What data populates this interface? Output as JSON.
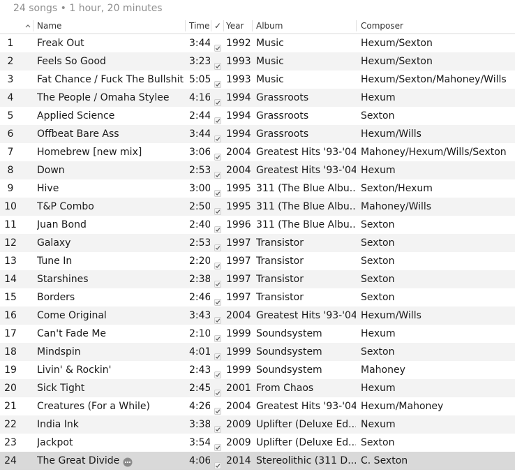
{
  "summary": {
    "text": "24 songs • 1 hour, 20 minutes"
  },
  "columns": {
    "name": "Name",
    "time": "Time",
    "check": "✓",
    "year": "Year",
    "album": "Album",
    "composer": "Composer"
  },
  "icons": {
    "sort": "chevron-up-icon",
    "check": "checkmark-icon",
    "more": "more-options-icon"
  },
  "colors": {
    "row_stripe": "#f3f3f3",
    "row_selected": "#d9d9d9",
    "summary_text": "#8f8f8f"
  },
  "tracks": [
    {
      "num": "1",
      "name": "Freak Out",
      "time": "3:44",
      "year": "1992",
      "album": "Music",
      "composer": "Hexum/Sexton"
    },
    {
      "num": "2",
      "name": "Feels So Good",
      "time": "3:23",
      "year": "1993",
      "album": "Music",
      "composer": "Hexum/Sexton"
    },
    {
      "num": "3",
      "name": "Fat Chance / Fuck The Bullshit",
      "time": "5:05",
      "year": "1993",
      "album": "Music",
      "composer": "Hexum/Sexton/Mahoney/Wills"
    },
    {
      "num": "4",
      "name": "The People / Omaha Stylee",
      "time": "4:16",
      "year": "1994",
      "album": "Grassroots",
      "composer": "Hexum"
    },
    {
      "num": "5",
      "name": "Applied Science",
      "time": "2:44",
      "year": "1994",
      "album": "Grassroots",
      "composer": "Sexton"
    },
    {
      "num": "6",
      "name": "Offbeat Bare Ass",
      "time": "3:44",
      "year": "1994",
      "album": "Grassroots",
      "composer": "Hexum/Wills"
    },
    {
      "num": "7",
      "name": "Homebrew [new mix]",
      "time": "3:06",
      "year": "2004",
      "album": "Greatest Hits '93-'04",
      "composer": "Mahoney/Hexum/Wills/Sexton"
    },
    {
      "num": "8",
      "name": "Down",
      "time": "2:53",
      "year": "2004",
      "album": "Greatest Hits '93-'04",
      "composer": "Hexum"
    },
    {
      "num": "9",
      "name": "Hive",
      "time": "3:00",
      "year": "1995",
      "album": "311 (The Blue Albu...",
      "composer": "Sexton/Hexum"
    },
    {
      "num": "10",
      "name": "T&P Combo",
      "time": "2:50",
      "year": "1995",
      "album": "311 (The Blue Albu...",
      "composer": "Mahoney/Wills"
    },
    {
      "num": "11",
      "name": "Juan Bond",
      "time": "2:40",
      "year": "1996",
      "album": "311 (The Blue Albu...",
      "composer": "Sexton"
    },
    {
      "num": "12",
      "name": "Galaxy",
      "time": "2:53",
      "year": "1997",
      "album": "Transistor",
      "composer": "Sexton"
    },
    {
      "num": "13",
      "name": "Tune In",
      "time": "2:20",
      "year": "1997",
      "album": "Transistor",
      "composer": "Sexton"
    },
    {
      "num": "14",
      "name": "Starshines",
      "time": "2:38",
      "year": "1997",
      "album": "Transistor",
      "composer": "Sexton"
    },
    {
      "num": "15",
      "name": "Borders",
      "time": "2:46",
      "year": "1997",
      "album": "Transistor",
      "composer": "Sexton"
    },
    {
      "num": "16",
      "name": "Come Original",
      "time": "3:43",
      "year": "2004",
      "album": "Greatest Hits '93-'04",
      "composer": "Hexum/Wills"
    },
    {
      "num": "17",
      "name": "Can't Fade Me",
      "time": "2:10",
      "year": "1999",
      "album": "Soundsystem",
      "composer": "Hexum"
    },
    {
      "num": "18",
      "name": "Mindspin",
      "time": "4:01",
      "year": "1999",
      "album": "Soundsystem",
      "composer": "Sexton"
    },
    {
      "num": "19",
      "name": "Livin' & Rockin'",
      "time": "2:43",
      "year": "1999",
      "album": "Soundsystem",
      "composer": "Mahoney"
    },
    {
      "num": "20",
      "name": "Sick Tight",
      "time": "2:45",
      "year": "2001",
      "album": "From Chaos",
      "composer": "Hexum"
    },
    {
      "num": "21",
      "name": "Creatures (For a While)",
      "time": "4:26",
      "year": "2004",
      "album": "Greatest Hits '93-'04",
      "composer": "Hexum/Mahoney"
    },
    {
      "num": "22",
      "name": "India Ink",
      "time": "3:38",
      "year": "2009",
      "album": "Uplifter (Deluxe Ed...",
      "composer": "Nexum"
    },
    {
      "num": "23",
      "name": "Jackpot",
      "time": "3:54",
      "year": "2009",
      "album": "Uplifter (Deluxe Ed...",
      "composer": "Sexton"
    },
    {
      "num": "24",
      "name": "The Great Divide",
      "time": "4:06",
      "year": "2014",
      "album": "Stereolithic (311 D...",
      "composer": "C. Sexton",
      "selected": true
    }
  ]
}
